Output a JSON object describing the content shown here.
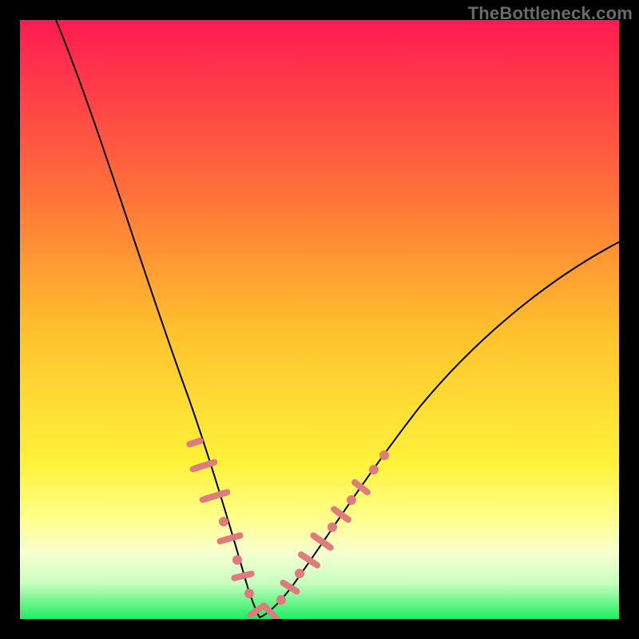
{
  "watermark": "TheBottleneck.com",
  "chart_data": {
    "type": "line",
    "title": "",
    "xlabel": "",
    "ylabel": "",
    "x_range": [
      0,
      100
    ],
    "y_range": [
      0,
      100
    ],
    "xlim": [
      0,
      100
    ],
    "ylim": [
      0,
      100
    ],
    "grid": false,
    "background_gradient": {
      "direction": "top-to-bottom",
      "stops": [
        {
          "pos": 0.0,
          "color": "#ff1a52"
        },
        {
          "pos": 0.5,
          "color": "#ffc12d"
        },
        {
          "pos": 0.82,
          "color": "#fffe60"
        },
        {
          "pos": 0.9,
          "color": "#ffffcc"
        },
        {
          "pos": 1.0,
          "color": "#1eec5f"
        }
      ]
    },
    "series": [
      {
        "name": "bottleneck-curve-left",
        "values": [
          {
            "x": 6,
            "y": 100
          },
          {
            "x": 12,
            "y": 85
          },
          {
            "x": 18,
            "y": 68
          },
          {
            "x": 23,
            "y": 50
          },
          {
            "x": 27,
            "y": 35
          },
          {
            "x": 30,
            "y": 23
          },
          {
            "x": 33,
            "y": 12
          },
          {
            "x": 36,
            "y": 4
          },
          {
            "x": 38,
            "y": 1
          },
          {
            "x": 40,
            "y": 0
          }
        ]
      },
      {
        "name": "bottleneck-curve-right",
        "values": [
          {
            "x": 40,
            "y": 0
          },
          {
            "x": 42,
            "y": 1
          },
          {
            "x": 45,
            "y": 4
          },
          {
            "x": 49,
            "y": 10
          },
          {
            "x": 54,
            "y": 18
          },
          {
            "x": 60,
            "y": 27
          },
          {
            "x": 68,
            "y": 37
          },
          {
            "x": 77,
            "y": 47
          },
          {
            "x": 88,
            "y": 56
          },
          {
            "x": 100,
            "y": 63
          }
        ]
      }
    ],
    "highlight_region": {
      "comment": "pink capsules/dots along curve where y is roughly between 0 and 25",
      "y_min": 0,
      "y_max": 25
    },
    "marker_points_along_curve": [
      {
        "x": 28.5,
        "y": 30
      },
      {
        "x": 29.5,
        "y": 26
      },
      {
        "x": 30.5,
        "y": 22
      },
      {
        "x": 31.5,
        "y": 19
      },
      {
        "x": 32.5,
        "y": 15
      },
      {
        "x": 33.5,
        "y": 12
      },
      {
        "x": 34.5,
        "y": 9
      },
      {
        "x": 35.5,
        "y": 6
      },
      {
        "x": 36.5,
        "y": 4
      },
      {
        "x": 37.5,
        "y": 2
      },
      {
        "x": 38.5,
        "y": 1
      },
      {
        "x": 39.5,
        "y": 0.3
      },
      {
        "x": 40.5,
        "y": 0.3
      },
      {
        "x": 41.5,
        "y": 0.5
      },
      {
        "x": 42.5,
        "y": 1.5
      },
      {
        "x": 43.5,
        "y": 3
      },
      {
        "x": 44.5,
        "y": 4.5
      },
      {
        "x": 45.5,
        "y": 6
      },
      {
        "x": 46.5,
        "y": 8
      },
      {
        "x": 47.5,
        "y": 10
      },
      {
        "x": 48.5,
        "y": 12
      },
      {
        "x": 49.5,
        "y": 14
      },
      {
        "x": 50.5,
        "y": 16
      },
      {
        "x": 51.5,
        "y": 18
      },
      {
        "x": 53.0,
        "y": 21
      },
      {
        "x": 55.0,
        "y": 25
      },
      {
        "x": 57.0,
        "y": 29
      }
    ]
  }
}
